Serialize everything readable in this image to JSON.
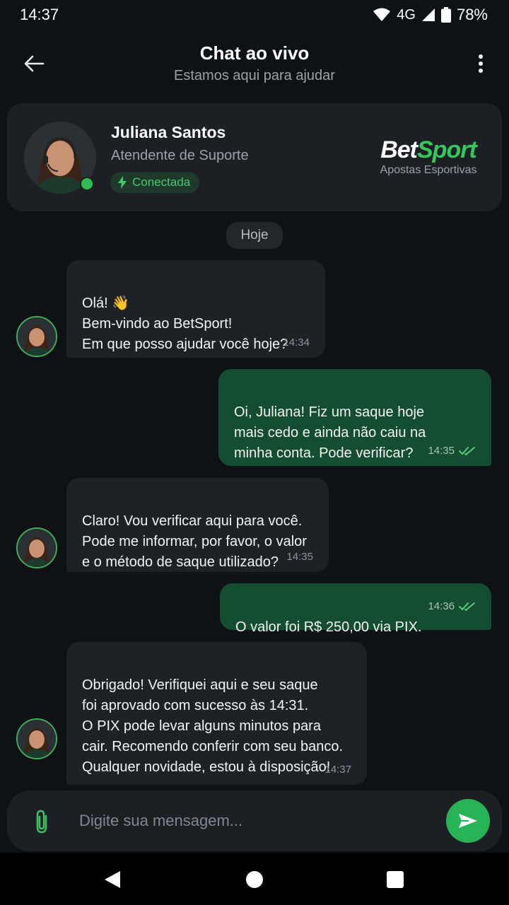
{
  "status_bar": {
    "time": "14:37",
    "network": "4G",
    "battery": "78%",
    "icons": [
      "wifi-icon",
      "signal-icon",
      "battery-icon"
    ]
  },
  "header": {
    "title": "Chat ao vivo",
    "subtitle": "Estamos aqui para ajudar"
  },
  "agent": {
    "name": "Juliana Santos",
    "role": "Atendente de Suporte",
    "status": "Conectada",
    "online": true
  },
  "brand": {
    "name_part1": "Bet",
    "name_part2": "Sport",
    "tagline": "Apostas Esportivas"
  },
  "date_separator": "Hoje",
  "messages": [
    {
      "direction": "in",
      "text": "Olá! 👋\nBem-vindo ao BetSport!\nEm que posso ajudar você hoje?",
      "time": "14:34"
    },
    {
      "direction": "out",
      "text": "Oi, Juliana! Fiz um saque hoje\nmais cedo e ainda não caiu na\nminha conta. Pode verificar?",
      "time": "14:35",
      "read": true
    },
    {
      "direction": "in",
      "text": "Claro! Vou verificar aqui para você.\nPode me informar, por favor, o valor\ne o método de saque utilizado?",
      "time": "14:35"
    },
    {
      "direction": "out",
      "text": "O valor foi R$ 250,00 via PIX.",
      "time": "14:36",
      "read": true
    },
    {
      "direction": "in",
      "text": "Obrigado! Verifiquei aqui e seu saque\nfoi aprovado com sucesso às 14:31.\nO PIX pode levar alguns minutos para\ncair. Recomendo conferir com seu banco.\nQualquer novidade, estou à disposição!",
      "time": "14:37"
    }
  ],
  "composer": {
    "placeholder": "Digite sua mensagem..."
  },
  "colors": {
    "accent": "#27b356",
    "outgoing_bubble": "#144d2f",
    "incoming_bubble": "#1e2226",
    "background": "#0f1215"
  }
}
